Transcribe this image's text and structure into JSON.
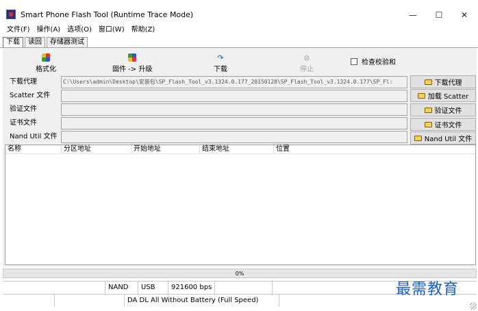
{
  "window": {
    "title": "Smart Phone Flash Tool (Runtime Trace Mode)"
  },
  "window_controls": {
    "minimize": "—",
    "maximize": "☐",
    "close": "✕"
  },
  "menu": [
    "文件(F)",
    "操作(A)",
    "选项(O)",
    "窗口(W)",
    "帮助(Z)"
  ],
  "tabs": [
    {
      "label": "下载",
      "active": true
    },
    {
      "label": "读回",
      "active": false
    },
    {
      "label": "存储器测试",
      "active": false
    }
  ],
  "toolbar": {
    "format": {
      "label": "格式化",
      "icon": "format-icon"
    },
    "firmware_upgrade": {
      "label": "固件 -> 升级",
      "icon": "firmware-icon"
    },
    "download": {
      "label": "下载",
      "icon": "download-icon",
      "glyph": "↷"
    },
    "stop": {
      "label": "停止",
      "icon": "stop-icon",
      "glyph": "⊘",
      "disabled": true
    },
    "checksum": {
      "label": "检查校验和",
      "checked": false
    }
  },
  "fields": [
    {
      "label": "下载代理",
      "value": "C:\\Users\\admin\\Desktop\\安装包\\SP_Flash_Tool_v3.1324.0.177_20150128\\SP_Flash_Tool_v3.1324.0.177\\SP_Fl:",
      "button": "下载代理"
    },
    {
      "label": "Scatter 文件",
      "value": "",
      "button": "加载 Scatter"
    },
    {
      "label": "验证文件",
      "value": "",
      "button": "验证文件"
    },
    {
      "label": "证书文件",
      "value": "",
      "button": "证书文件"
    },
    {
      "label": "Nand Util 文件",
      "value": "",
      "button": "Nand Util 文件"
    }
  ],
  "table": {
    "columns": [
      "名称",
      "分区地址",
      "开始地址",
      "结束地址",
      "位置"
    ],
    "rows": []
  },
  "progress": {
    "percent": 0,
    "label": "0%"
  },
  "status_bar": {
    "row1": [
      "",
      "NAND",
      "USB",
      "921600 bps",
      "",
      ""
    ],
    "row2": [
      "",
      "",
      "DA DL All Without Battery (Full Speed)",
      ""
    ]
  },
  "watermark": "最需教育",
  "colors": {
    "accent": "#1d5ec8",
    "panel": "#f0f0f0",
    "button": "#e1e1e1"
  }
}
